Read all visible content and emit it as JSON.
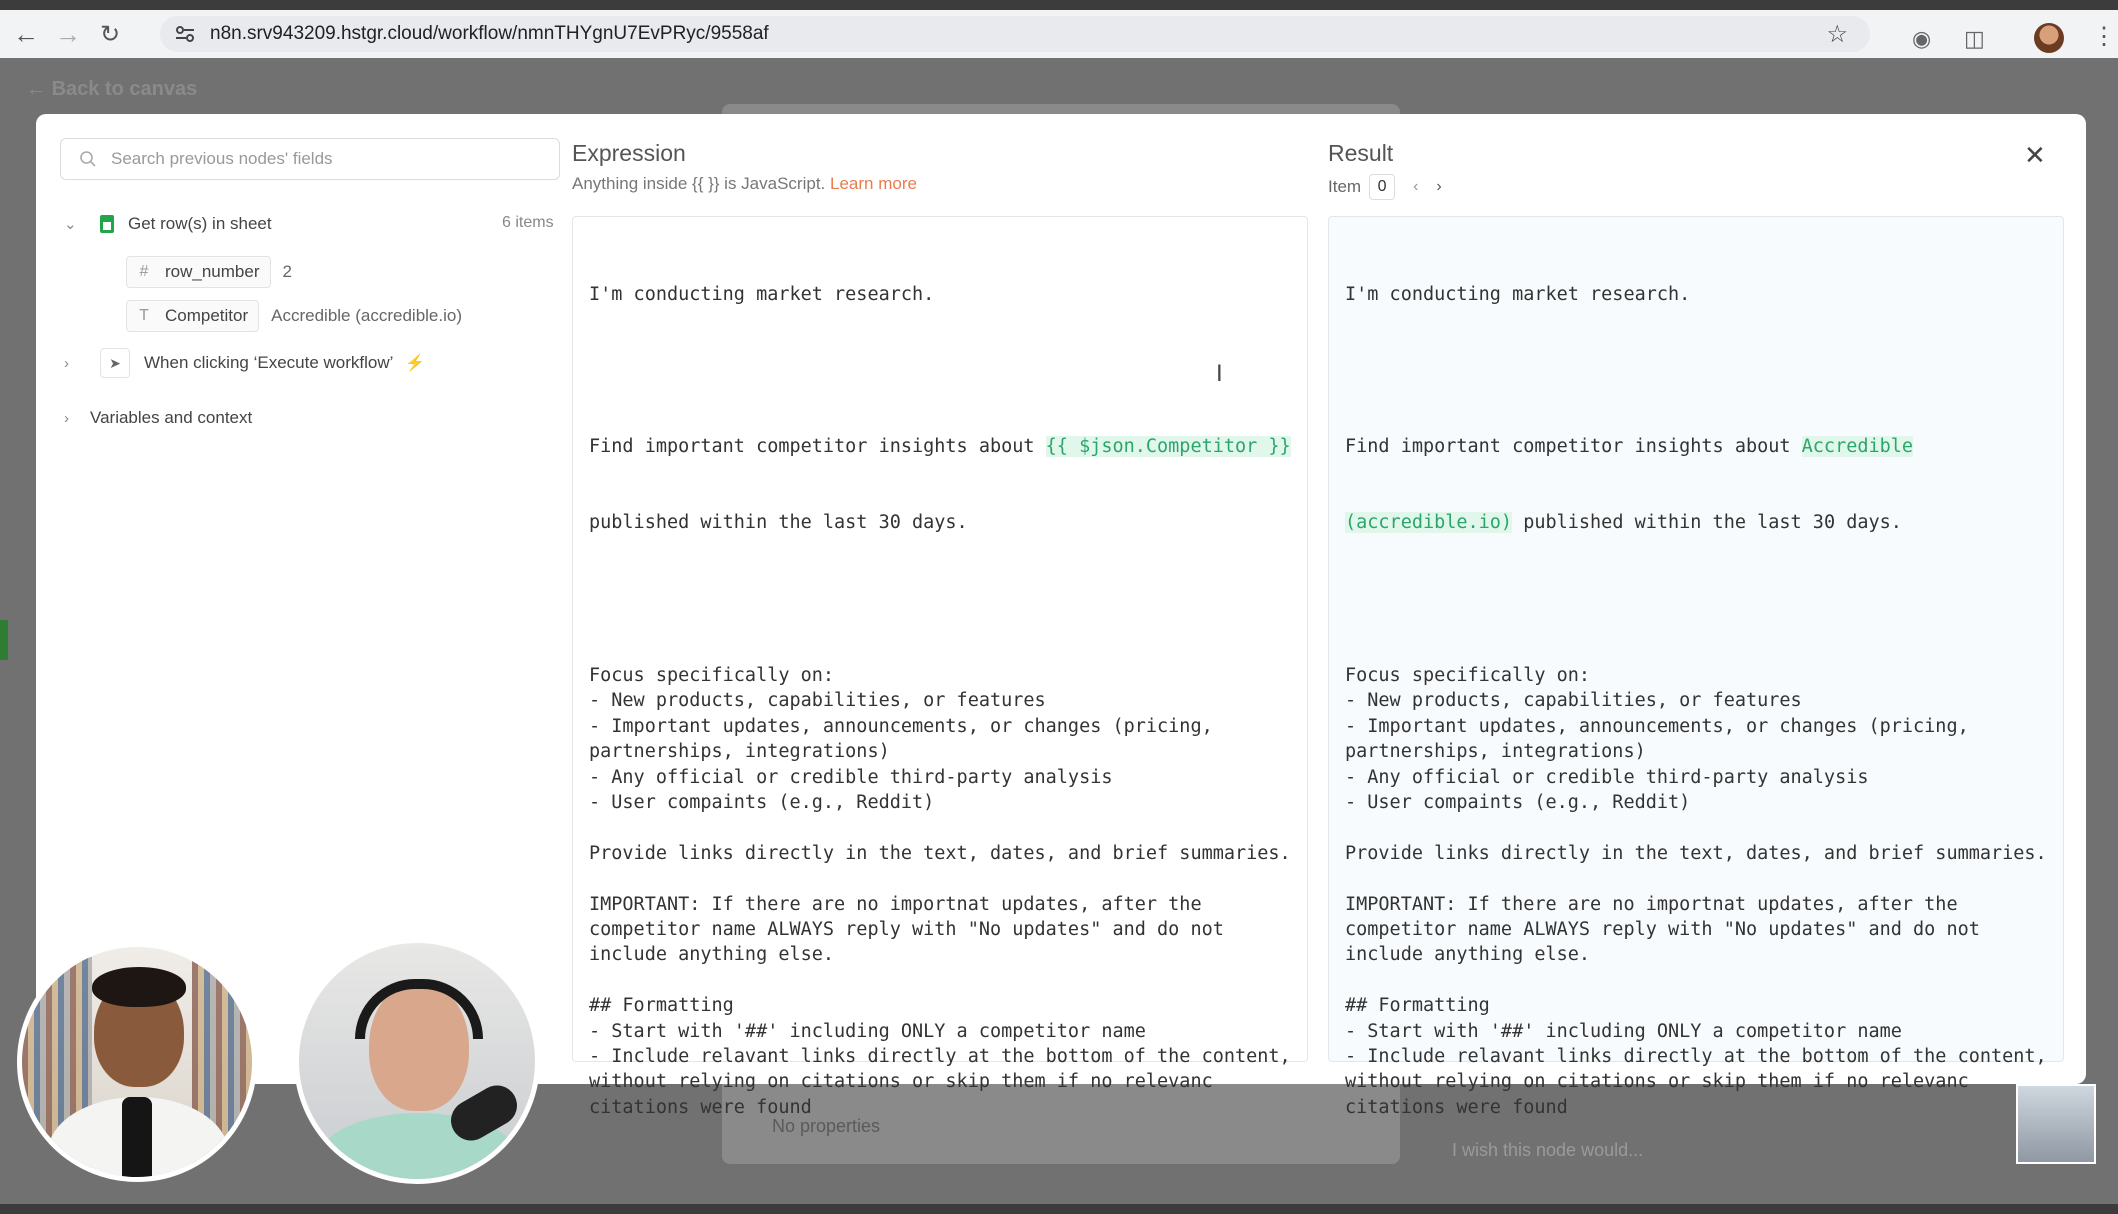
{
  "browser": {
    "url": "n8n.srv943209.hstgr.cloud/workflow/nmnTHYgnU7EvPRyc/9558af"
  },
  "canvas": {
    "back_label": "Back to canvas",
    "behind_no_properties": "No properties",
    "behind_wish_placeholder": "I wish this node would..."
  },
  "left_panel": {
    "search_placeholder": "Search previous nodes' fields",
    "node1": {
      "label": "Get row(s) in sheet",
      "count": "6 items",
      "fields": [
        {
          "type_glyph": "#",
          "name": "row_number",
          "value": "2"
        },
        {
          "type_glyph": "T",
          "name": "Competitor",
          "value": "Accredible (accredible.io)"
        }
      ]
    },
    "node2": {
      "label": "When clicking ‘Execute workflow’"
    },
    "node3": {
      "label": "Variables and context"
    }
  },
  "expression": {
    "title": "Expression",
    "subtitle_prefix": "Anything inside {{ }} is JavaScript. ",
    "learn_more": "Learn more",
    "line1": "I'm conducting market research.",
    "line2a": "Find important competitor insights about ",
    "line2b": "{{ $json.Competitor }}",
    "line3": "published within the last 30 days.",
    "body": [
      "Focus specifically on:",
      "- New products, capabilities, or features",
      "- Important updates, announcements, or changes (pricing,",
      "partnerships, integrations)",
      "- Any official or credible third-party analysis",
      "- User compaints (e.g., Reddit)",
      "",
      "Provide links directly in the text, dates, and brief summaries.",
      "",
      "IMPORTANT: If there are no importnat updates, after the",
      "competitor name ALWAYS reply with \"No updates\" and do not",
      "include anything else.",
      "",
      "## Formatting",
      "- Start with '##' including ONLY a competitor name",
      "- Include relavant links directly at the bottom of the content,",
      "without relying on citations or skip them if no relevanc",
      "citations were found"
    ]
  },
  "result": {
    "title": "Result",
    "item_label": "Item",
    "item_index": "0",
    "line1": "I'm conducting market research.",
    "line2a": "Find important competitor insights about ",
    "line2b": "Accredible",
    "line3a": "(accredible.io)",
    "line3b": " published within the last 30 days."
  }
}
